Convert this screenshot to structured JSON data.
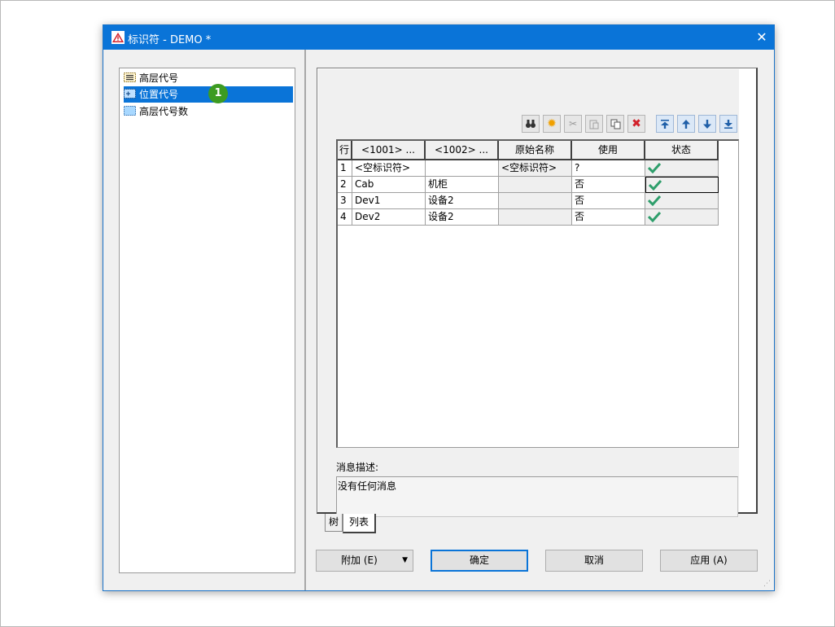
{
  "window": {
    "title": "标识符 - DEMO *",
    "close_glyph": "✕"
  },
  "tree": {
    "items": [
      {
        "label": "高层代号",
        "icon": "list-icon",
        "selected": false
      },
      {
        "label": "位置代号",
        "icon": "location-icon",
        "selected": true
      },
      {
        "label": "高层代号数",
        "icon": "grid-icon",
        "selected": false
      }
    ],
    "callout": "1"
  },
  "toolbar": {
    "icons": [
      "binoculars-icon",
      "new-star-icon",
      "cut-icon",
      "paste-icon",
      "copy-icon",
      "delete-icon",
      "move-top-icon",
      "move-up-icon",
      "move-down-icon",
      "move-bottom-icon"
    ]
  },
  "table": {
    "headers": [
      "行",
      "<1001> ...",
      "<1002> ...",
      "原始名称",
      "使用",
      "状态"
    ],
    "rows": [
      {
        "num": "1",
        "c1001": "<空标识符>",
        "c1002": "",
        "original": "<空标识符>",
        "use": "?",
        "status": "ok"
      },
      {
        "num": "2",
        "c1001": "Cab",
        "c1002": "机柜",
        "original": "",
        "use": "否",
        "status": "ok"
      },
      {
        "num": "3",
        "c1001": "Dev1",
        "c1002": "设备2",
        "original": "",
        "use": "否",
        "status": "ok"
      },
      {
        "num": "4",
        "c1001": "Dev2",
        "c1002": "设备2",
        "original": "",
        "use": "否",
        "status": "ok"
      }
    ]
  },
  "message": {
    "label": "消息描述:",
    "text": "没有任何消息"
  },
  "tabs": [
    {
      "label": "树"
    },
    {
      "label": "列表",
      "active": true
    }
  ],
  "buttons": {
    "add": "附加 (E)",
    "add_arrow": "▼",
    "ok": "确定",
    "cancel": "取消",
    "apply": "应用 (A)"
  },
  "colors": {
    "accent": "#0a74d8",
    "callout": "#3c9b21",
    "check": "#2e9e6b"
  }
}
